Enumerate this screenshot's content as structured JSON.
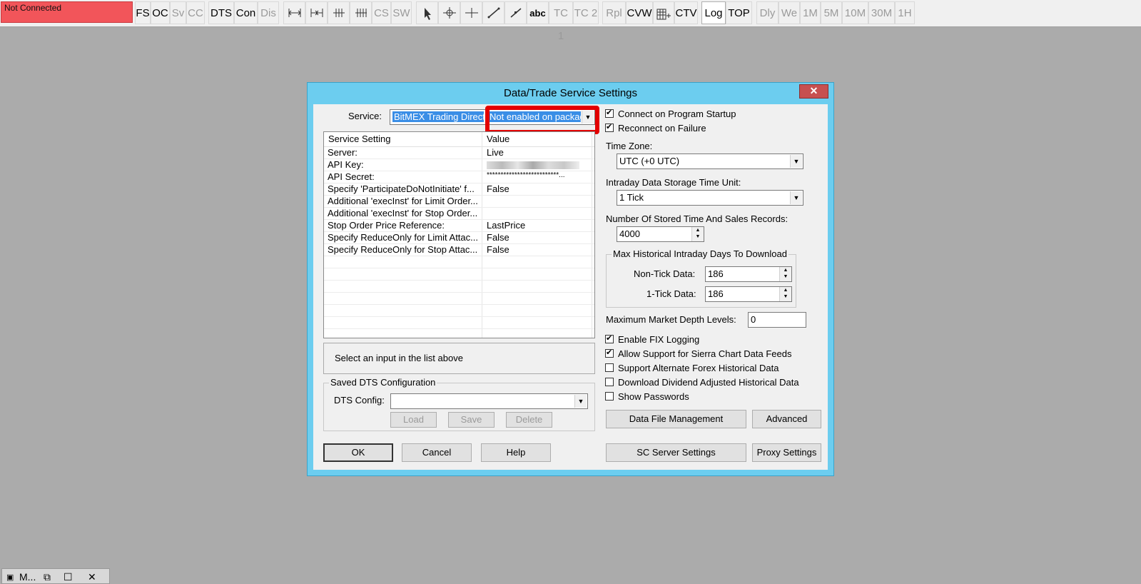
{
  "toolbar": {
    "status": "Not Connected",
    "buttons": {
      "fs": "FS",
      "oc": "OC",
      "sv": "Sv",
      "cc": "CC",
      "dts": "DTS",
      "con": "Con",
      "dis": "Dis",
      "cs": "CS",
      "sw": "SW",
      "abc": "abc",
      "tc1": "TC 1",
      "tc2": "TC 2",
      "rpl": "Rpl",
      "cvw": "CVW",
      "ctv": "CTV",
      "log": "Log",
      "top": "TOP",
      "dly": "Dly",
      "we": "We",
      "m1": "1M",
      "m5": "5M",
      "m10": "10M",
      "m30": "30M",
      "h1": "1H"
    }
  },
  "dialog": {
    "title": "Data/Trade Service Settings",
    "close": "✕",
    "service_label": "Service:",
    "service_value": "BitMEX Trading Direct",
    "service_status": "Not enabled on package",
    "list": {
      "col_setting": "Service Setting",
      "col_value": "Value",
      "rows": [
        {
          "setting": "Server:",
          "value": "Live"
        },
        {
          "setting": "API Key:",
          "value": ""
        },
        {
          "setting": "API Secret:",
          "value": "**************************..."
        },
        {
          "setting": "Specify 'ParticipateDoNotInitiate' f...",
          "value": "False"
        },
        {
          "setting": "Additional 'execInst' for Limit Order...",
          "value": ""
        },
        {
          "setting": "Additional 'execInst' for Stop Order...",
          "value": ""
        },
        {
          "setting": "Stop Order Price Reference:",
          "value": "LastPrice"
        },
        {
          "setting": "Specify ReduceOnly for Limit Attac...",
          "value": "False"
        },
        {
          "setting": "Specify ReduceOnly for Stop Attac...",
          "value": "False"
        }
      ]
    },
    "hint": "Select an input in the list above",
    "saved_group": "Saved DTS Configuration",
    "dts_config_label": "DTS Config:",
    "load": "Load",
    "save": "Save",
    "delete": "Delete",
    "ok": "OK",
    "cancel": "Cancel",
    "help": "Help",
    "connect_startup": "Connect on Program Startup",
    "reconnect_failure": "Reconnect on Failure",
    "time_zone_label": "Time Zone:",
    "time_zone_value": "UTC (+0 UTC)",
    "storage_unit_label": "Intraday Data Storage Time Unit:",
    "storage_unit_value": "1 Tick",
    "stored_records_label": "Number Of Stored Time And Sales Records:",
    "stored_records_value": "4000",
    "hist_group": "Max Historical Intraday Days To Download",
    "non_tick_label": "Non-Tick Data:",
    "non_tick_value": "186",
    "one_tick_label": "1-Tick Data:",
    "one_tick_value": "186",
    "depth_label": "Maximum Market Depth Levels:",
    "depth_value": "0",
    "fix_logging": "Enable FIX Logging",
    "sc_feeds": "Allow Support for Sierra Chart Data Feeds",
    "alt_forex": "Support Alternate Forex Historical Data",
    "dividend": "Download Dividend Adjusted Historical Data",
    "show_passwords": "Show Passwords",
    "data_file_mgmt": "Data File Management",
    "advanced": "Advanced",
    "sc_server": "SC Server Settings",
    "proxy": "Proxy Settings"
  },
  "taskbar": {
    "title": "M...",
    "restore": "⧉",
    "maximize": "☐",
    "close": "✕"
  }
}
